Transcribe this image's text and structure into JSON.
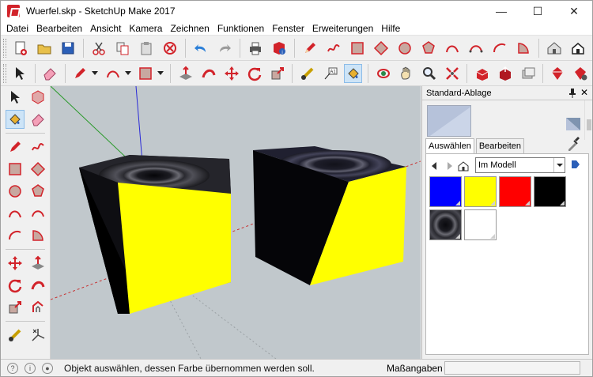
{
  "window": {
    "title": "Wuerfel.skp - SketchUp Make 2017",
    "minimize": "—",
    "maximize": "☐",
    "close": "✕"
  },
  "menu": [
    "Datei",
    "Bearbeiten",
    "Ansicht",
    "Kamera",
    "Zeichnen",
    "Funktionen",
    "Fenster",
    "Erweiterungen",
    "Hilfe"
  ],
  "tray": {
    "title": "Standard-Ablage",
    "tabs": [
      "Auswählen",
      "Bearbeiten"
    ],
    "active_tab": 0,
    "collection": "Im Modell",
    "swatches": [
      {
        "name": "blue",
        "color": "#0000ff"
      },
      {
        "name": "yellow",
        "color": "#ffff00"
      },
      {
        "name": "red",
        "color": "#ff0000"
      },
      {
        "name": "black",
        "color": "#000000"
      },
      {
        "name": "dark-texture",
        "color": "#2a2a2e"
      },
      {
        "name": "white",
        "color": "#ffffff"
      }
    ]
  },
  "status": {
    "message": "Objekt auswählen, dessen Farbe übernommen werden soll.",
    "measure_label": "Maßangaben"
  },
  "colors": {
    "sky": "#c1c8cc",
    "accent_red": "#d2232a",
    "cube_yellow": "#ffff00",
    "cube_dark": "#1c1c24"
  }
}
